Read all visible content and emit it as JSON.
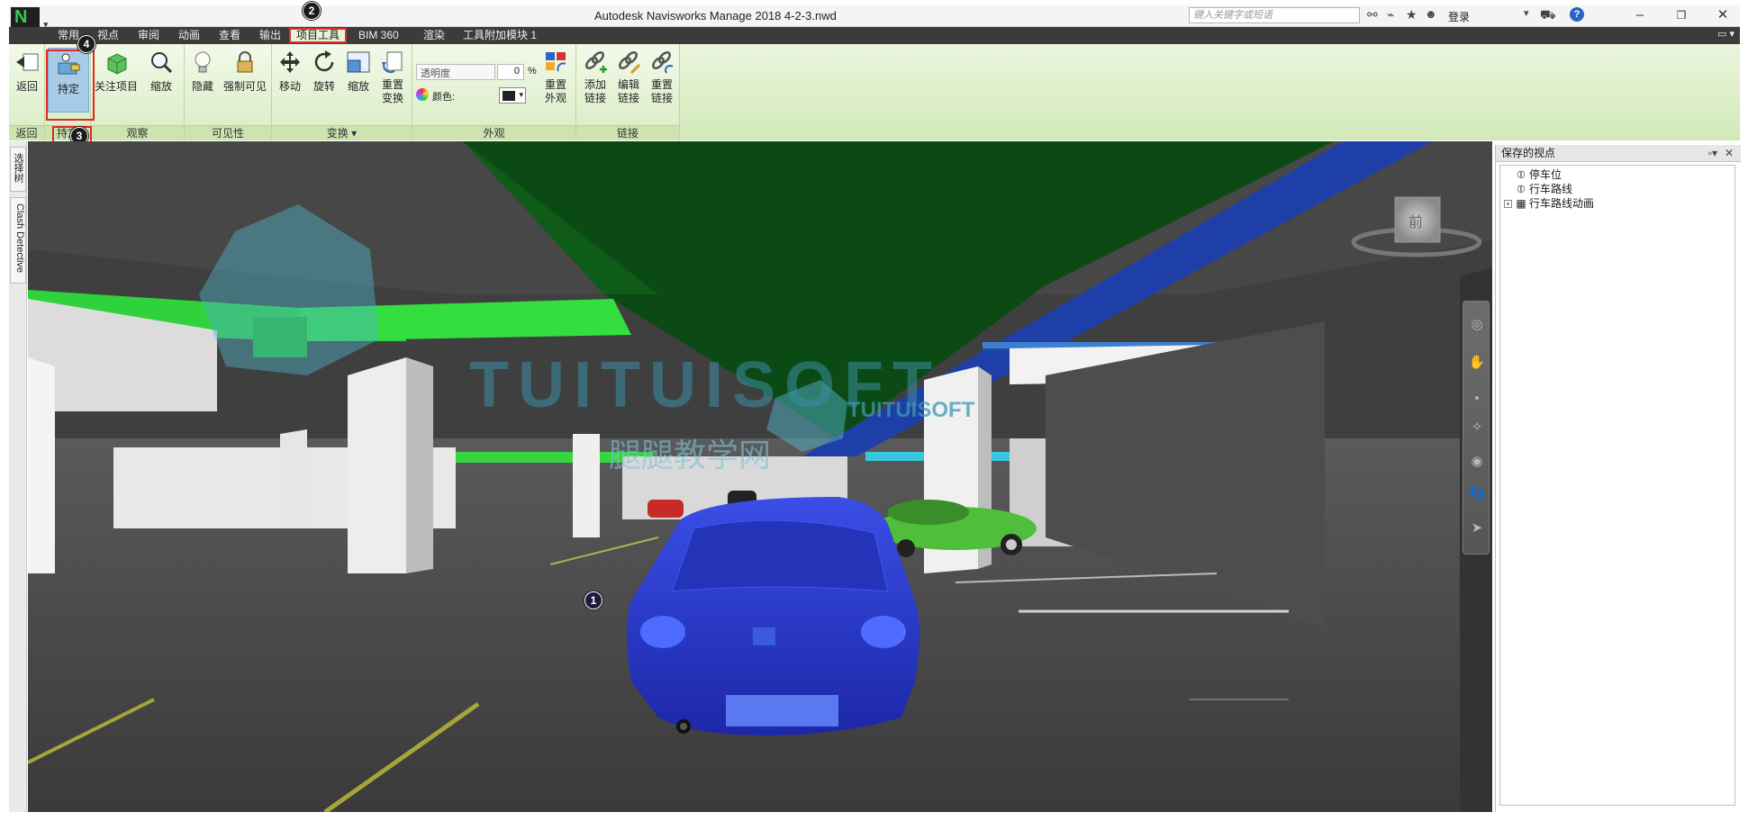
{
  "titlebar": {
    "app_logo": "N",
    "title": "Autodesk Navisworks Manage 2018    4-2-3.nwd",
    "search_placeholder": "键入关键字或短语",
    "login_label": "登录",
    "icons": [
      "binoculars-icon",
      "satellite-icon",
      "star-icon",
      "user-icon",
      "cart-icon",
      "help-icon"
    ],
    "help_glyph": "?"
  },
  "menu": {
    "tabs": [
      "常用",
      "视点",
      "审阅",
      "动画",
      "查看",
      "输出",
      "项目工具",
      "BIM 360",
      "渲染",
      "工具附加模块 1"
    ],
    "active_tab": "项目工具"
  },
  "ribbon": {
    "groups": {
      "return": {
        "label": "返回",
        "buttons": {
          "return": "返回"
        }
      },
      "hold": {
        "label": "持定",
        "buttons": {
          "hold": "持定"
        }
      },
      "observe": {
        "label": "观察",
        "buttons": {
          "focus": "关注项目",
          "zoom": "缩放"
        }
      },
      "visibility": {
        "label": "可见性",
        "buttons": {
          "hide": "隐藏",
          "force_visible": "强制可见"
        }
      },
      "transform": {
        "label": "变换",
        "buttons": {
          "move": "移动",
          "rotate": "旋转",
          "scale": "缩放",
          "reset_line1": "重置",
          "reset_line2": "变换"
        }
      },
      "appearance": {
        "label": "外观",
        "opacity_label": "透明度",
        "opacity_value": "0",
        "opacity_unit": "%",
        "color_label": "颜色:",
        "reset_line1": "重置",
        "reset_line2": "外观"
      },
      "links": {
        "label": "链接",
        "buttons": {
          "add_line1": "添加",
          "add_line2": "链接",
          "edit_line1": "编辑",
          "edit_line2": "链接",
          "reset_line1": "重置",
          "reset_line2": "链接"
        }
      }
    }
  },
  "badges": {
    "b1": "1",
    "b2": "2",
    "b3": "3",
    "b4": "4"
  },
  "left_dock": {
    "tabs": [
      "选择树",
      "Clash Detective"
    ]
  },
  "watermark": {
    "brand": "TUITUISOFT",
    "brand_small": "TUITUISOFT",
    "cn": "腿腿教学网"
  },
  "viewcube": {
    "label": "前"
  },
  "saved_viewpoints": {
    "title": "保存的视点",
    "items": [
      {
        "label": "停车位",
        "type": "viewpoint"
      },
      {
        "label": "行车路线",
        "type": "viewpoint"
      },
      {
        "label": "行车路线动画",
        "type": "animation",
        "expandable": true
      }
    ]
  },
  "colors": {
    "menu_bg": "#3b3b3b",
    "ribbon_green": "#d9ecc4",
    "highlight_red": "#e02626",
    "selected_car_blue": "#2f3fd4",
    "pipe_green": "#33d93a",
    "ceiling_green": "#0b4a14"
  }
}
